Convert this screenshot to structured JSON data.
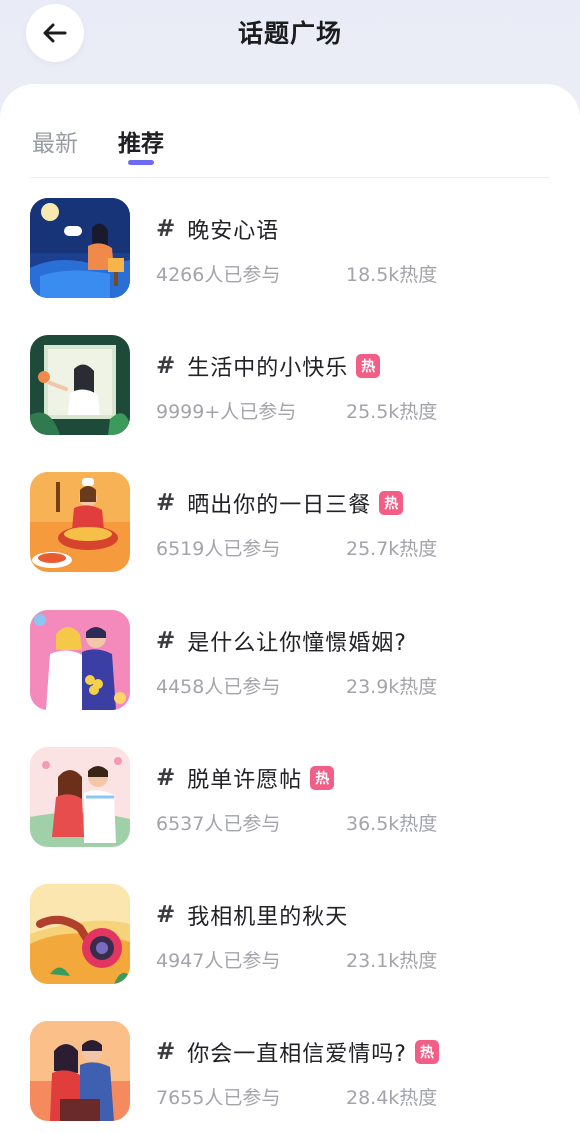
{
  "header": {
    "title": "话题广场",
    "back_icon": "arrow-left-icon"
  },
  "tabs": [
    {
      "label": "最新",
      "active": false
    },
    {
      "label": "推荐",
      "active": true
    }
  ],
  "colors": {
    "accent": "#6d6cf0",
    "hot_badge": "#f25e86"
  },
  "topics": [
    {
      "name": "晚安心语",
      "participants": "4266人已参与",
      "heat": "18.5k热度",
      "hot": false,
      "badge": ""
    },
    {
      "name": "生活中的小快乐",
      "participants": "9999+人已参与",
      "heat": "25.5k热度",
      "hot": true,
      "badge": "热"
    },
    {
      "name": "晒出你的一日三餐",
      "participants": "6519人已参与",
      "heat": "25.7k热度",
      "hot": true,
      "badge": "热"
    },
    {
      "name": "是什么让你憧憬婚姻?",
      "participants": "4458人已参与",
      "heat": "23.9k热度",
      "hot": false,
      "badge": ""
    },
    {
      "name": "脱单许愿帖",
      "participants": "6537人已参与",
      "heat": "36.5k热度",
      "hot": true,
      "badge": "热"
    },
    {
      "name": "我相机里的秋天",
      "participants": "4947人已参与",
      "heat": "23.1k热度",
      "hot": false,
      "badge": ""
    },
    {
      "name": "你会一直相信爱情吗?",
      "participants": "7655人已参与",
      "heat": "28.4k热度",
      "hot": true,
      "badge": "热"
    }
  ]
}
